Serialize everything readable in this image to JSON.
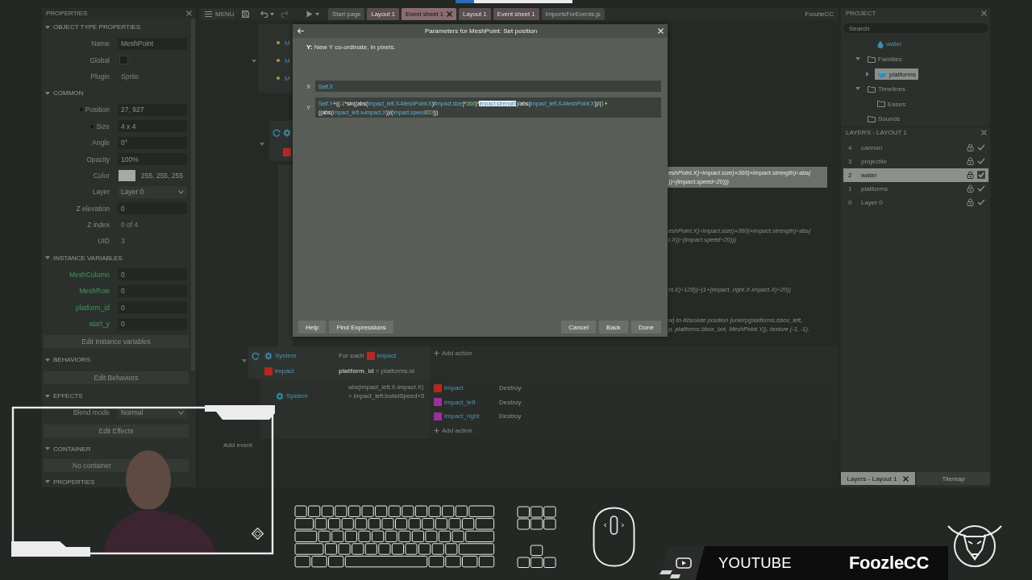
{
  "properties": {
    "title": "PROPERTIES",
    "sections": [
      {
        "title": "OBJECT TYPE PROPERTIES",
        "expanded": true,
        "rows": [
          {
            "kind": "field",
            "label": "Name",
            "value": "MeshPoint"
          },
          {
            "kind": "checkbox",
            "label": "Global",
            "checked": false
          },
          {
            "kind": "info",
            "label": "Plugin",
            "value": "Sprite"
          }
        ]
      },
      {
        "title": "COMMON",
        "expanded": true,
        "rows": [
          {
            "kind": "field",
            "label": "Position",
            "value": "27, 927",
            "bullet": true
          },
          {
            "kind": "field",
            "label": "Size",
            "value": "4 x 4",
            "bullet": true
          },
          {
            "kind": "field",
            "label": "Angle",
            "value": "0°",
            "bullet": false
          },
          {
            "kind": "field",
            "label": "Opacity",
            "value": "100%",
            "bullet": false
          },
          {
            "kind": "color",
            "label": "Color",
            "value": "255, 255, 255",
            "bullet": false
          },
          {
            "kind": "dropdown",
            "label": "Layer",
            "value": "Layer 0",
            "bullet": false
          },
          {
            "kind": "field",
            "label": "Z elevation",
            "value": "0",
            "bullet": false
          },
          {
            "kind": "info",
            "label": "Z index",
            "value": "0 of 4",
            "bullet": false
          },
          {
            "kind": "info",
            "label": "UID",
            "value": "3",
            "bullet": false
          }
        ]
      },
      {
        "title": "INSTANCE VARIABLES",
        "expanded": true,
        "rows": [
          {
            "kind": "variable",
            "label": "MeshColumn",
            "value": "0"
          },
          {
            "kind": "variable",
            "label": "MeshRow",
            "value": "0"
          },
          {
            "kind": "variable",
            "label": "platform_id",
            "value": "0"
          },
          {
            "kind": "variable",
            "label": "start_y",
            "value": "0"
          }
        ],
        "button": "Edit Instance variables"
      },
      {
        "title": "BEHAVIORS",
        "expanded": true,
        "button": "Edit Behaviors"
      },
      {
        "title": "EFFECTS",
        "expanded": true,
        "rows": [
          {
            "kind": "dropdown",
            "label": "Blend mode",
            "value": "Normal"
          }
        ],
        "button": "Edit Effects"
      },
      {
        "title": "CONTAINER",
        "expanded": true,
        "note": "No container"
      },
      {
        "title": "PROPERTIES",
        "expanded": true
      }
    ]
  },
  "toolbar": {
    "menu": "MENU",
    "tabs": [
      {
        "label": "Start page",
        "kind": "plain",
        "selected": false,
        "closable": false
      },
      {
        "label": "Layout 1",
        "kind": "tinted",
        "selected": false,
        "closable": false
      },
      {
        "label": "Event sheet 1",
        "kind": "tinted",
        "selected": true,
        "closable": true
      },
      {
        "label": "Layout 1",
        "kind": "tinted",
        "selected": false,
        "closable": false
      },
      {
        "label": "Event sheet 1",
        "kind": "tinted",
        "selected": false,
        "closable": false
      },
      {
        "label": "ImportsForEvents.js",
        "kind": "plain",
        "selected": false,
        "closable": false
      }
    ],
    "user": "FoozleCC"
  },
  "event_sheet": {
    "outline_rows": [
      {
        "text": "M"
      },
      {
        "text": "M"
      },
      {
        "text": "M"
      }
    ],
    "event_stub": {
      "expanded": true,
      "loop": true,
      "conditions": [
        {
          "kind": "system"
        },
        {
          "kind": "object",
          "color": "#b3291f"
        }
      ]
    },
    "action_fragments": [
      {
        "lines": [
          "eshPoint.X)÷impact.size)×360)×impact.strength)÷abs(",
          "))÷(impact.speed÷20)))"
        ],
        "selected": true
      },
      {
        "lines": [
          "eshPoint.X)÷impact.size)×360)×impact.strength)÷abs(",
          "t.X))÷(impact.speed÷20)))"
        ],
        "selected": false
      },
      {
        "lines": [
          "ct.X)÷128))÷(1+(impact_right.X-impact.X)÷20))"
        ],
        "selected": false
      },
      {
        "lines": [
          "w) to Absolute position (unlerp(platforms.bbox_left,",
          "p, platforms.bbox_bot, MeshPoint.Y)), texture (-1, -1)."
        ],
        "selected": false
      }
    ],
    "events": [
      {
        "expanded": true,
        "loop": true,
        "conditions": [
          {
            "object": "System",
            "kind": "system",
            "text": "For each",
            "param": {
              "name": "impact",
              "color": "#b3291f"
            }
          },
          {
            "object": "impact",
            "kind": "object",
            "color": "#b3291f",
            "text": "**platform_id** = platforms.id"
          }
        ],
        "add_action": "Add action",
        "children": [
          {
            "loop": false,
            "conditions": [
              {
                "object": "System",
                "kind": "system",
                "text": "abs(impact_left.X-impact.X) > impact_left.bulletSpeed+5"
              }
            ],
            "actions": [
              {
                "object": "impact",
                "color": "#b3291f",
                "action": "Destroy"
              },
              {
                "object": "impact_left",
                "color": "#a12d9c",
                "action": "Destroy"
              },
              {
                "object": "impact_right",
                "color": "#a12d9c",
                "action": "Destroy"
              }
            ],
            "add_action": "Add action"
          }
        ]
      }
    ],
    "add_event": "Add event"
  },
  "dialog": {
    "title": "Parameters for MeshPoint: Set position",
    "description": "**Y:** New Y co-ordinate, in pixels.",
    "params": [
      {
        "label": "X",
        "lines": [
          {
            "tokens": [
              {
                "text": "Self.X",
                "kind": "object"
              }
            ]
          }
        ]
      },
      {
        "label": "Y",
        "lines": [
          {
            "tokens": [
              {
                "text": "Self.Y",
                "kind": "object"
              },
              {
                "text": "+((",
                "kind": "op"
              },
              {
                "text": "-1",
                "kind": "number"
              },
              {
                "text": "*",
                "kind": "op"
              },
              {
                "text": "sin",
                "kind": "func"
              },
              {
                "text": "((",
                "kind": "op"
              },
              {
                "text": "abs",
                "kind": "func"
              },
              {
                "text": "(",
                "kind": "op"
              },
              {
                "text": "impact_left.X",
                "kind": "object"
              },
              {
                "text": "-",
                "kind": "op"
              },
              {
                "text": "MeshPoint.X",
                "kind": "object"
              },
              {
                "text": ")/",
                "kind": "op"
              },
              {
                "text": "impact.size",
                "kind": "object"
              },
              {
                "text": ")*",
                "kind": "op"
              },
              {
                "text": "360",
                "kind": "number"
              },
              {
                "text": ")*",
                "kind": "op"
              },
              {
                "text": "impact.strength",
                "kind": "selected"
              },
              {
                "text": ")/",
                "kind": "op"
              },
              {
                "text": "abs",
                "kind": "func"
              },
              {
                "text": "(",
                "kind": "op"
              },
              {
                "text": "impact_left.X",
                "kind": "object"
              },
              {
                "text": "-",
                "kind": "op"
              },
              {
                "text": "MeshPoint.X",
                "kind": "object"
              },
              {
                "text": "))/(",
                "kind": "op"
              },
              {
                "text": "1",
                "kind": "number"
              },
              {
                "text": "+",
                "kind": "op"
              }
            ]
          },
          {
            "tokens": [
              {
                "text": "((",
                "kind": "op"
              },
              {
                "text": "abs",
                "kind": "func"
              },
              {
                "text": "(",
                "kind": "op"
              },
              {
                "text": "impact_left.x",
                "kind": "object"
              },
              {
                "text": "-",
                "kind": "op"
              },
              {
                "text": "impact.X",
                "kind": "object"
              },
              {
                "text": "))/(",
                "kind": "op"
              },
              {
                "text": "impact.speed",
                "kind": "object"
              },
              {
                "text": "/",
                "kind": "op"
              },
              {
                "text": "20",
                "kind": "number"
              },
              {
                "text": ")))",
                "kind": "op"
              }
            ]
          }
        ]
      }
    ],
    "left_buttons": [
      "Help",
      "Find Expressions"
    ],
    "right_buttons": [
      "Cancel",
      "Back",
      "Done"
    ]
  },
  "project": {
    "title": "PROJECT",
    "search": {
      "placeholder": "Search"
    },
    "tree": [
      {
        "label": "water",
        "kind": "object",
        "selected": false
      },
      {
        "label": "Families",
        "kind": "folder",
        "expanded": true,
        "selected": false,
        "children": [
          {
            "label": "platforms",
            "kind": "family",
            "expanded": false,
            "selected": true
          }
        ]
      },
      {
        "label": "Timelines",
        "kind": "folder",
        "expanded": true,
        "selected": false,
        "children": [
          {
            "label": "Eases",
            "kind": "folder",
            "selected": false
          }
        ]
      },
      {
        "label": "Sounds",
        "kind": "folder",
        "selected": false
      }
    ]
  },
  "layers": {
    "title": "LAYERS - LAYOUT 1",
    "rows": [
      {
        "index": "4",
        "name": "cannon",
        "selected": false,
        "visible": true
      },
      {
        "index": "3",
        "name": "projectile",
        "selected": false,
        "visible": true
      },
      {
        "index": "2",
        "name": "water",
        "selected": true,
        "visible": true
      },
      {
        "index": "1",
        "name": "platforms",
        "selected": false,
        "visible": true
      },
      {
        "index": "0",
        "name": "Layer 0",
        "selected": false,
        "visible": true
      }
    ],
    "tabs": [
      {
        "label": "Layers - Layout 1",
        "selected": true,
        "closable": true
      },
      {
        "label": "Tilemap",
        "selected": false,
        "closable": false
      }
    ]
  },
  "stream": {
    "platform": "YOUTUBE",
    "channel": "FoozleCC"
  }
}
